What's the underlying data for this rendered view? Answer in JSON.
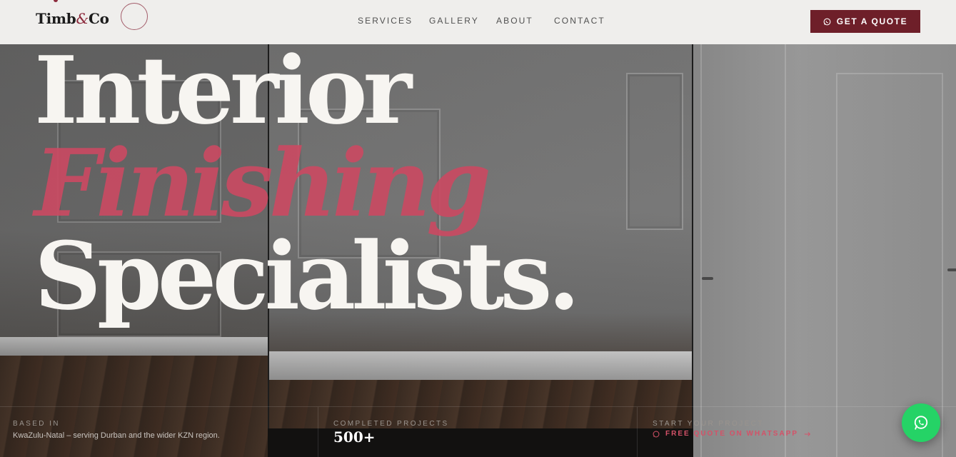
{
  "brand": {
    "name_part1": "Timb",
    "amp": "&",
    "name_part2": "Co"
  },
  "nav": {
    "links": [
      "SERVICES",
      "GALLERY",
      "ABOUT",
      "CONTACT"
    ],
    "cta_label": "GET A QUOTE"
  },
  "hero": {
    "line1": "Interior",
    "line2": "Finishing",
    "line3": "Specialists."
  },
  "stats": [
    {
      "label": "BASED IN",
      "text": "KwaZulu-Natal – serving Durban and the wider KZN region."
    },
    {
      "label": "COMPLETED PROJECTS",
      "number": "500+"
    },
    {
      "label": "START YOUR PROJECT",
      "link": "FREE QUOTE ON WHATSAPP"
    }
  ],
  "colors": {
    "accent": "#6e1f29",
    "highlight": "#c94a62",
    "whatsapp": "#25d366",
    "nav_bg": "#efeeec"
  },
  "icons": {
    "cta": "whatsapp-icon",
    "stat_link": "whatsapp-icon",
    "stat_arrow": "arrow-right-icon",
    "fab": "whatsapp-icon"
  }
}
